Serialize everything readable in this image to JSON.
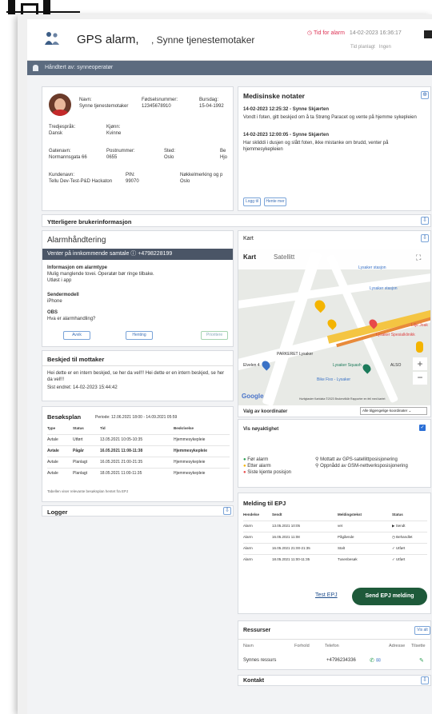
{
  "header": {
    "title": "GPS alarm,",
    "subtitle": ", Synne tjenestemotaker",
    "alarm_time_label": "Tid for alarm",
    "alarm_time_value": "14-02-2023 16:36:17",
    "planned_label": "Tid planlagt",
    "planned_value": "Ingen"
  },
  "handled_by": "Håndtert av: synneoperatør",
  "person": {
    "name_label": "Navn:",
    "name_value": "Synne tjenestemotaker",
    "ssn_label": "Fødselsnummer:",
    "ssn_value": "12345678910",
    "bday_label": "Bursdag:",
    "bday_value": "15-04-1992",
    "lang_label": "Tredjespråk:",
    "lang_value": "Dansk",
    "gender_label": "Kjønn:",
    "gender_value": "Kvinne",
    "street_label": "Gatenavn:",
    "street_value": "Normannsgata 66",
    "zip_label": "Postnummer:",
    "zip_value": "0655",
    "place_label": "Sted:",
    "place_value": "Oslo",
    "be_label": "Be",
    "be_value": "Hjo",
    "customer_label": "Kundenavn:",
    "customer_value": "Tellu Dev-Test-P&D Hackaton",
    "pin_label": "PIN:",
    "pin_value": "99070",
    "key_label": "Nøkkelmerking og p",
    "key_value": "Oslo"
  },
  "extra_info": "Ytterligere brukerinformasjon",
  "medical": {
    "title": "Medisinske notater",
    "entry1_head": "14-02-2023 12:25:32 - Synne Skjærten",
    "entry1_body": "Vondt i foten, gitt beskjed om å ta Strøng Paracet og vente på hjemme sykepleien",
    "entry2_head": "14-02-2023 12:00:05 - Synne Skjærten",
    "entry2_body": "Har skliddi i dusjen og slått foten, ikke mistanke om brudd, venter på hjemmesykepleien",
    "btn_more": "Logg til",
    "btn_hide": "Hente mer"
  },
  "alarm": {
    "title": "Alarmhåndtering",
    "waiting": "Venter på innkommende samtale",
    "phone": "+4798228199",
    "info_label": "Informasjon om alarmtype",
    "info_lines": [
      "Mulig manglende tovei. Operatør bør ringe tilbake.",
      "Utløst i app"
    ],
    "sender_label": "Sendermodell",
    "sender_value": "iPhone",
    "obs_label": "OBS",
    "obs_value": "Hva er alarmhandling?",
    "btn_a": "Avvik",
    "btn_b": "Henting",
    "btn_c": "Prioritere"
  },
  "message": {
    "title": "Beskjed til mottaker",
    "body": "Hei dette er en intern beskjed, se her da vel!!! Hei dette er en intern beskjed, se her da vel!!!",
    "edited": "Sist endret: 14-02-2023 15:44:42"
  },
  "visit": {
    "title": "Besøksplan",
    "period": "Periode: 12.06.2021 18:00 - 14.09.2021 05:59",
    "cols": [
      "Type",
      "Status",
      "Tid",
      "Beskrivelse"
    ],
    "rows": [
      [
        "Avtale",
        "Utført",
        "13.05.2021 10:05-10:35",
        "Hjemmesykepleie"
      ],
      [
        "Avtale",
        "Pågår",
        "16.05.2021 11:08-11:38",
        "Hjemmesykepleie"
      ],
      [
        "Avtale",
        "Planlagt",
        "16.05.2021 21:00-21:35",
        "Hjemmesykepleie"
      ],
      [
        "Avtale",
        "Planlagt",
        "18.05.2021 11:00-11:35",
        "Hjemmesykepleie"
      ]
    ],
    "footer": "Tabellen viser relevante besøksplan hentet fra EPJ"
  },
  "logger": "Logger",
  "map": {
    "title": "Kart",
    "tab_map": "Kart",
    "tab_sat": "Satellitt",
    "google": "Google",
    "places": [
      "Lysaker stasjon",
      "Lysaker stasjon",
      "Lilje Joak",
      "Lysaker Spesialklinikk",
      "PARKERET Lysaker",
      "Lysaker Squash",
      "Bike Fixx - Lysaker",
      "Elvelen 4",
      "ALSO"
    ],
    "footer": "Hurtigtaster  Kartdata ©2023  Brukervilkår  Rapporter en feil med kartet"
  },
  "coords": {
    "label": "Valg av koordinater",
    "select": "Alle tilgjengelige koordinater"
  },
  "accuracy": {
    "label": "Vis nøyaktighet"
  },
  "legend": {
    "before": "Før alarm",
    "after": "Etter alarm",
    "last": "Siste kjente posisjon",
    "gps": "Mottatt av GPS-satellittposisjonering",
    "gsm": "Oppnådd av GSM-nettverksposisjonering"
  },
  "epj": {
    "title": "Melding til EPJ",
    "cols": [
      "Hendelse",
      "Sendt",
      "Meldingstekst",
      "Status"
    ],
    "rows": [
      [
        "Alarm",
        "13.05.2021 10:05",
        "vet",
        "Sendt"
      ],
      [
        "Alarm",
        "16.05.2021 11:08",
        "Pågående",
        "Behandlet"
      ],
      [
        "Alarm",
        "16.05.2021 21:00-21:35",
        "Stalt",
        "Utført"
      ],
      [
        "Alarm",
        "18.05.2021 11:00-11:35",
        "Tusenbesøk",
        "Utført"
      ]
    ],
    "test": "Test EPJ",
    "send": "Send EPJ melding"
  },
  "resources": {
    "title": "Ressurser",
    "add": "Vis alt",
    "cols": [
      "Navn",
      "Forhold",
      "Telefon",
      "Adresse",
      "Tilsette"
    ],
    "name": "Synnes ressurs",
    "phone": "+4796234336"
  },
  "contact": "Kontakt"
}
